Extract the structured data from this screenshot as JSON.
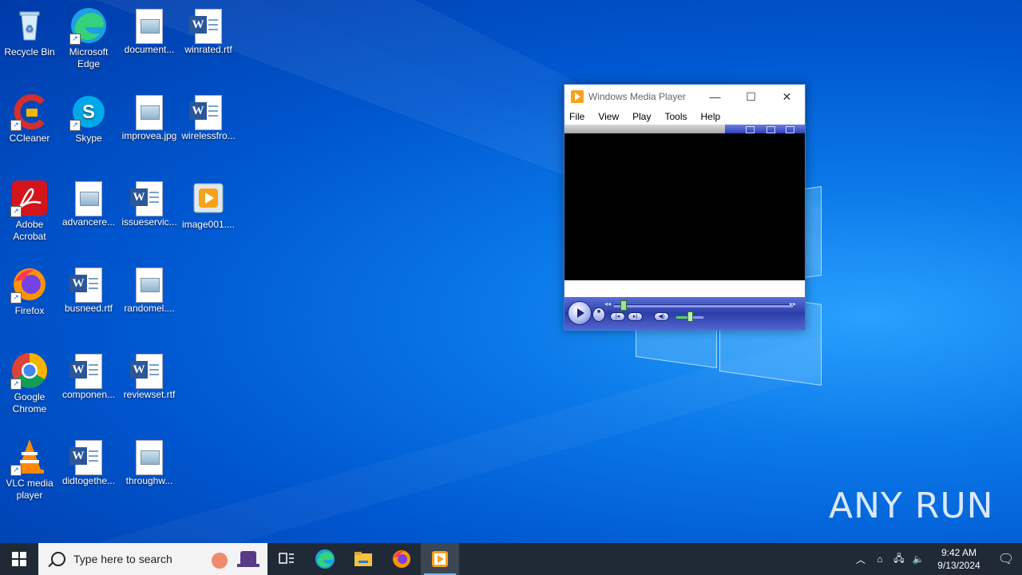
{
  "desktop": {
    "icons": [
      {
        "label": "Recycle Bin",
        "icon": "recycle-bin-icon"
      },
      {
        "label": "Microsoft Edge",
        "icon": "edge-icon"
      },
      {
        "label": "document...",
        "icon": "image-file-icon"
      },
      {
        "label": "winrated.rtf",
        "icon": "word-doc-icon"
      },
      {
        "label": "CCleaner",
        "icon": "ccleaner-icon"
      },
      {
        "label": "Skype",
        "icon": "skype-icon"
      },
      {
        "label": "improvea.jpg",
        "icon": "image-file-icon"
      },
      {
        "label": "wirelessfro...",
        "icon": "word-doc-icon"
      },
      {
        "label": "Adobe Acrobat",
        "icon": "acrobat-icon"
      },
      {
        "label": "advancere...",
        "icon": "image-file-icon"
      },
      {
        "label": "issueservic...",
        "icon": "word-doc-icon"
      },
      {
        "label": "image001....",
        "icon": "media-file-icon"
      },
      {
        "label": "Firefox",
        "icon": "firefox-icon"
      },
      {
        "label": "busneed.rtf",
        "icon": "word-doc-icon"
      },
      {
        "label": "randomel....",
        "icon": "image-file-icon"
      },
      {
        "label": "Google Chrome",
        "icon": "chrome-icon"
      },
      {
        "label": "componen...",
        "icon": "word-doc-icon"
      },
      {
        "label": "reviewset.rtf",
        "icon": "word-doc-icon"
      },
      {
        "label": "VLC media player",
        "icon": "vlc-icon"
      },
      {
        "label": "didtogethe...",
        "icon": "word-doc-icon"
      },
      {
        "label": "throughw...",
        "icon": "image-file-icon"
      }
    ]
  },
  "wmp": {
    "title": "Windows Media Player",
    "menu": [
      "File",
      "View",
      "Play",
      "Tools",
      "Help"
    ],
    "seek_fraction": 0.05,
    "volume_fraction": 0.5
  },
  "taskbar": {
    "search_placeholder": "Type here to search",
    "time": "9:42 AM",
    "date": "9/13/2024"
  },
  "watermark": "ANY RUN",
  "colors": {
    "taskbar": "#1f2a36",
    "accent": "#76b9ed",
    "wmp_controls": "#2c3ea8"
  }
}
